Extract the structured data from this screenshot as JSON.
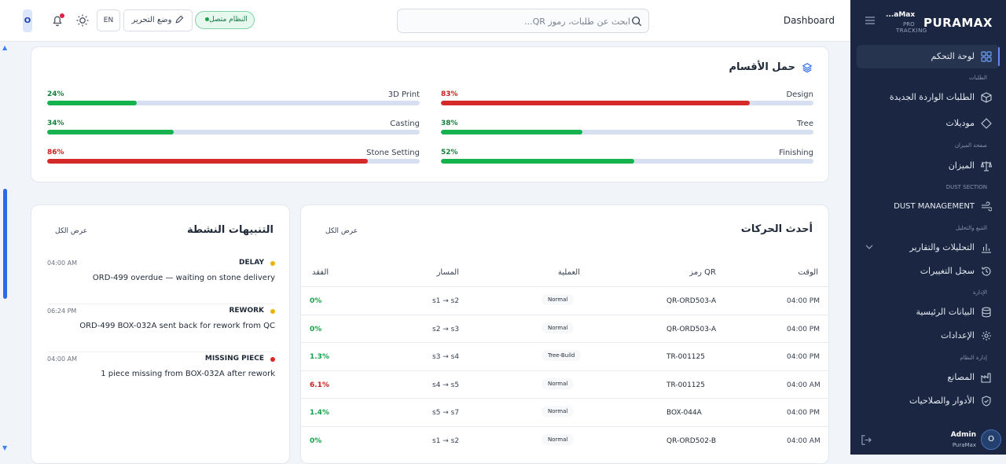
{
  "header": {
    "page_title": "Dashboard",
    "search_placeholder": "ابحث عن طلبات، رموز QR...",
    "status_label": "النظام متصل",
    "edit_mode_label": "وضع التحرير",
    "language_label": "EN",
    "user_initial": "O"
  },
  "departments": {
    "title": "حمل الأقسام",
    "items": [
      {
        "name": "Design",
        "percent": "83%",
        "value": 0.83,
        "color": "#d42a2a"
      },
      {
        "name": "3D Print",
        "percent": "24%",
        "value": 0.24,
        "color": "#16b24e"
      },
      {
        "name": "Tree",
        "percent": "38%",
        "value": 0.38,
        "color": "#16b24e"
      },
      {
        "name": "Casting",
        "percent": "34%",
        "value": 0.34,
        "color": "#16b24e"
      },
      {
        "name": "Finishing",
        "percent": "52%",
        "value": 0.52,
        "color": "#16b24e"
      },
      {
        "name": "Stone Setting",
        "percent": "86%",
        "value": 0.86,
        "color": "#d42a2a"
      }
    ]
  },
  "alerts": {
    "title": "التنبيهات النشطة",
    "view_all": "عرض الكل",
    "items": [
      {
        "type": "DELAY",
        "time": "04:00 AM",
        "message": "ORD-499 overdue — waiting on stone delivery",
        "color": "#eab308"
      },
      {
        "type": "REWORK",
        "time": "06:24 PM",
        "message": "ORD-499 BOX-032A sent back for rework from QC",
        "color": "#eab308"
      },
      {
        "type": "MISSING PIECE",
        "time": "04:00 AM",
        "message": "1 piece missing from BOX-032A after rework",
        "color": "#dc2626"
      }
    ]
  },
  "movements": {
    "title": "أحدث الحركات",
    "view_all": "عرض الكل",
    "columns": {
      "time": "الوقت",
      "qr": "رمز QR",
      "operation": "العملية",
      "path": "المسار",
      "loss": "الفقد"
    },
    "rows": [
      {
        "time": "04:00 PM",
        "qr": "QR-ORD503-A",
        "operation": "Normal",
        "path": "s1 → s2",
        "loss": "0%",
        "loss_color": "#16a34a"
      },
      {
        "time": "04:00 PM",
        "qr": "QR-ORD503-A",
        "operation": "Normal",
        "path": "s2 → s3",
        "loss": "0%",
        "loss_color": "#16a34a"
      },
      {
        "time": "04:00 PM",
        "qr": "TR-001125",
        "operation": "Tree-Build",
        "path": "s3 → s4",
        "loss": "1.3%",
        "loss_color": "#16a34a"
      },
      {
        "time": "04:00 AM",
        "qr": "TR-001125",
        "operation": "Normal",
        "path": "s4 → s5",
        "loss": "6.1%",
        "loss_color": "#c81e1e"
      },
      {
        "time": "04:00 PM",
        "qr": "BOX-044A",
        "operation": "Normal",
        "path": "s5 → s7",
        "loss": "1.4%",
        "loss_color": "#16a34a"
      },
      {
        "time": "04:00 AM",
        "qr": "QR-ORD502-B",
        "operation": "Normal",
        "path": "s1 → s2",
        "loss": "0%",
        "loss_color": "#16a34a"
      }
    ]
  },
  "sidebar": {
    "logo": "PURAMAX",
    "logo_sub": "...aMax",
    "logo_pro": "PRO",
    "logo_tracking": "TRACKING",
    "sections": {
      "orders": "الطلبات",
      "scale_page": "صفحة الميزان",
      "dust": "DUST SECTION",
      "tracking": "التتبع والتحليل",
      "admin": "الإدارة",
      "system": "إدارة النظام"
    },
    "items": {
      "dashboard": "لوحة التحكم",
      "new_orders": "الطلبات الواردة الجديدة",
      "models": "موديلات",
      "scale": "الميزان",
      "dust": "DUST MANAGEMENT",
      "analytics": "التحليلات والتقارير",
      "changelog": "سجل التغييرات",
      "master_data": "البيانات الرئيسية",
      "settings": "الإعدادات",
      "factories": "المصانع",
      "roles": "الأدوار والصلاحيات"
    },
    "user": {
      "name": "Admin",
      "role": "PuraMax",
      "initial": "O"
    }
  }
}
